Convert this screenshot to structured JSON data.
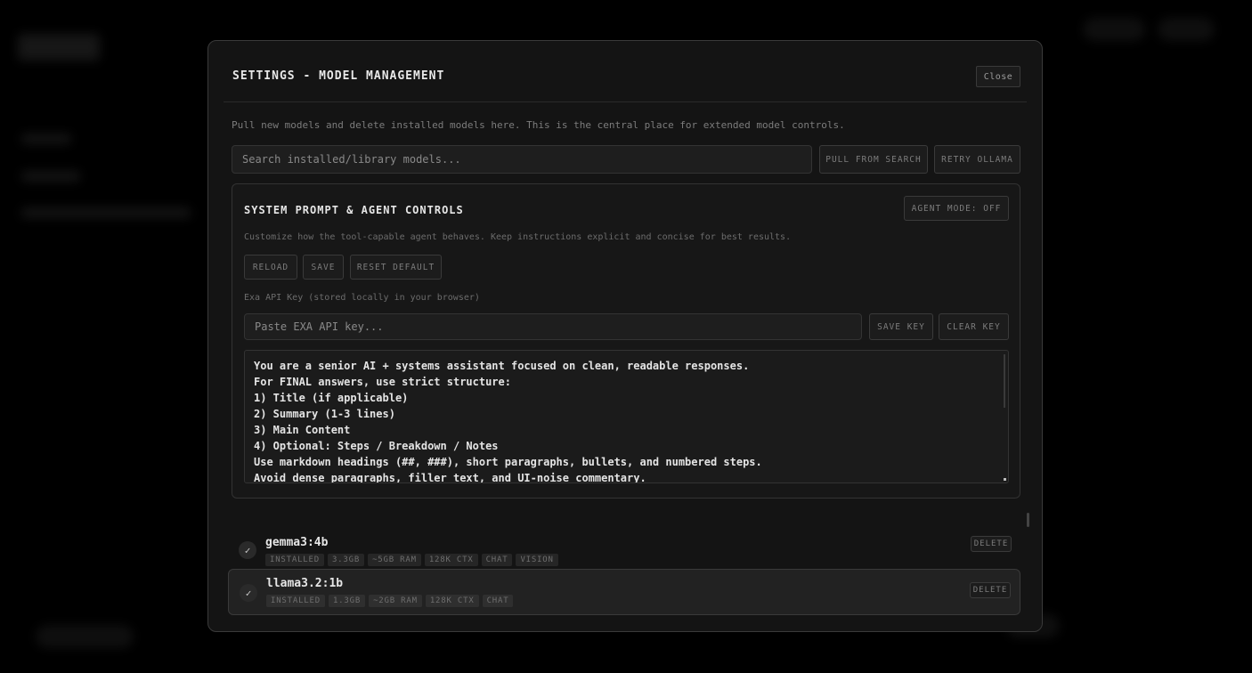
{
  "modal": {
    "title": "SETTINGS - MODEL MANAGEMENT",
    "close_label": "Close",
    "intro": "Pull new models and delete installed models here. This is the central place for extended model controls.",
    "search_placeholder": "Search installed/library models...",
    "pull_label": "PULL FROM SEARCH",
    "retry_label": "RETRY OLLAMA"
  },
  "agent_panel": {
    "title": "SYSTEM PROMPT & AGENT CONTROLS",
    "agent_mode_label": "AGENT MODE: OFF",
    "description": "Customize how the tool-capable agent behaves. Keep instructions explicit and concise for best results.",
    "reload_label": "RELOAD",
    "save_label": "SAVE",
    "reset_label": "RESET DEFAULT",
    "api_key_label": "Exa API Key (stored locally in your browser)",
    "api_key_placeholder": "Paste EXA API key...",
    "save_key_label": "SAVE KEY",
    "clear_key_label": "CLEAR KEY",
    "prompt_lines": [
      "You are a senior AI + systems assistant focused on clean, readable responses.",
      "For FINAL answers, use strict structure:",
      "1) Title (if applicable)",
      "2) Summary (1-3 lines)",
      "3) Main Content",
      "4) Optional: Steps / Breakdown / Notes",
      "Use markdown headings (##, ###), short paragraphs, bullets, and numbered steps.",
      "Avoid dense paragraphs, filler text, and UI-noise commentary."
    ]
  },
  "models": [
    {
      "check": "✓",
      "name": "gemma3:4b",
      "tags": [
        "INSTALLED",
        "3.3GB",
        "~5GB RAM",
        "128K CTX",
        "CHAT",
        "VISION"
      ],
      "delete_label": "DELETE"
    },
    {
      "check": "✓",
      "name": "llama3.2:1b",
      "tags": [
        "INSTALLED",
        "1.3GB",
        "~2GB RAM",
        "128K CTX",
        "CHAT"
      ],
      "delete_label": "DELETE"
    }
  ]
}
